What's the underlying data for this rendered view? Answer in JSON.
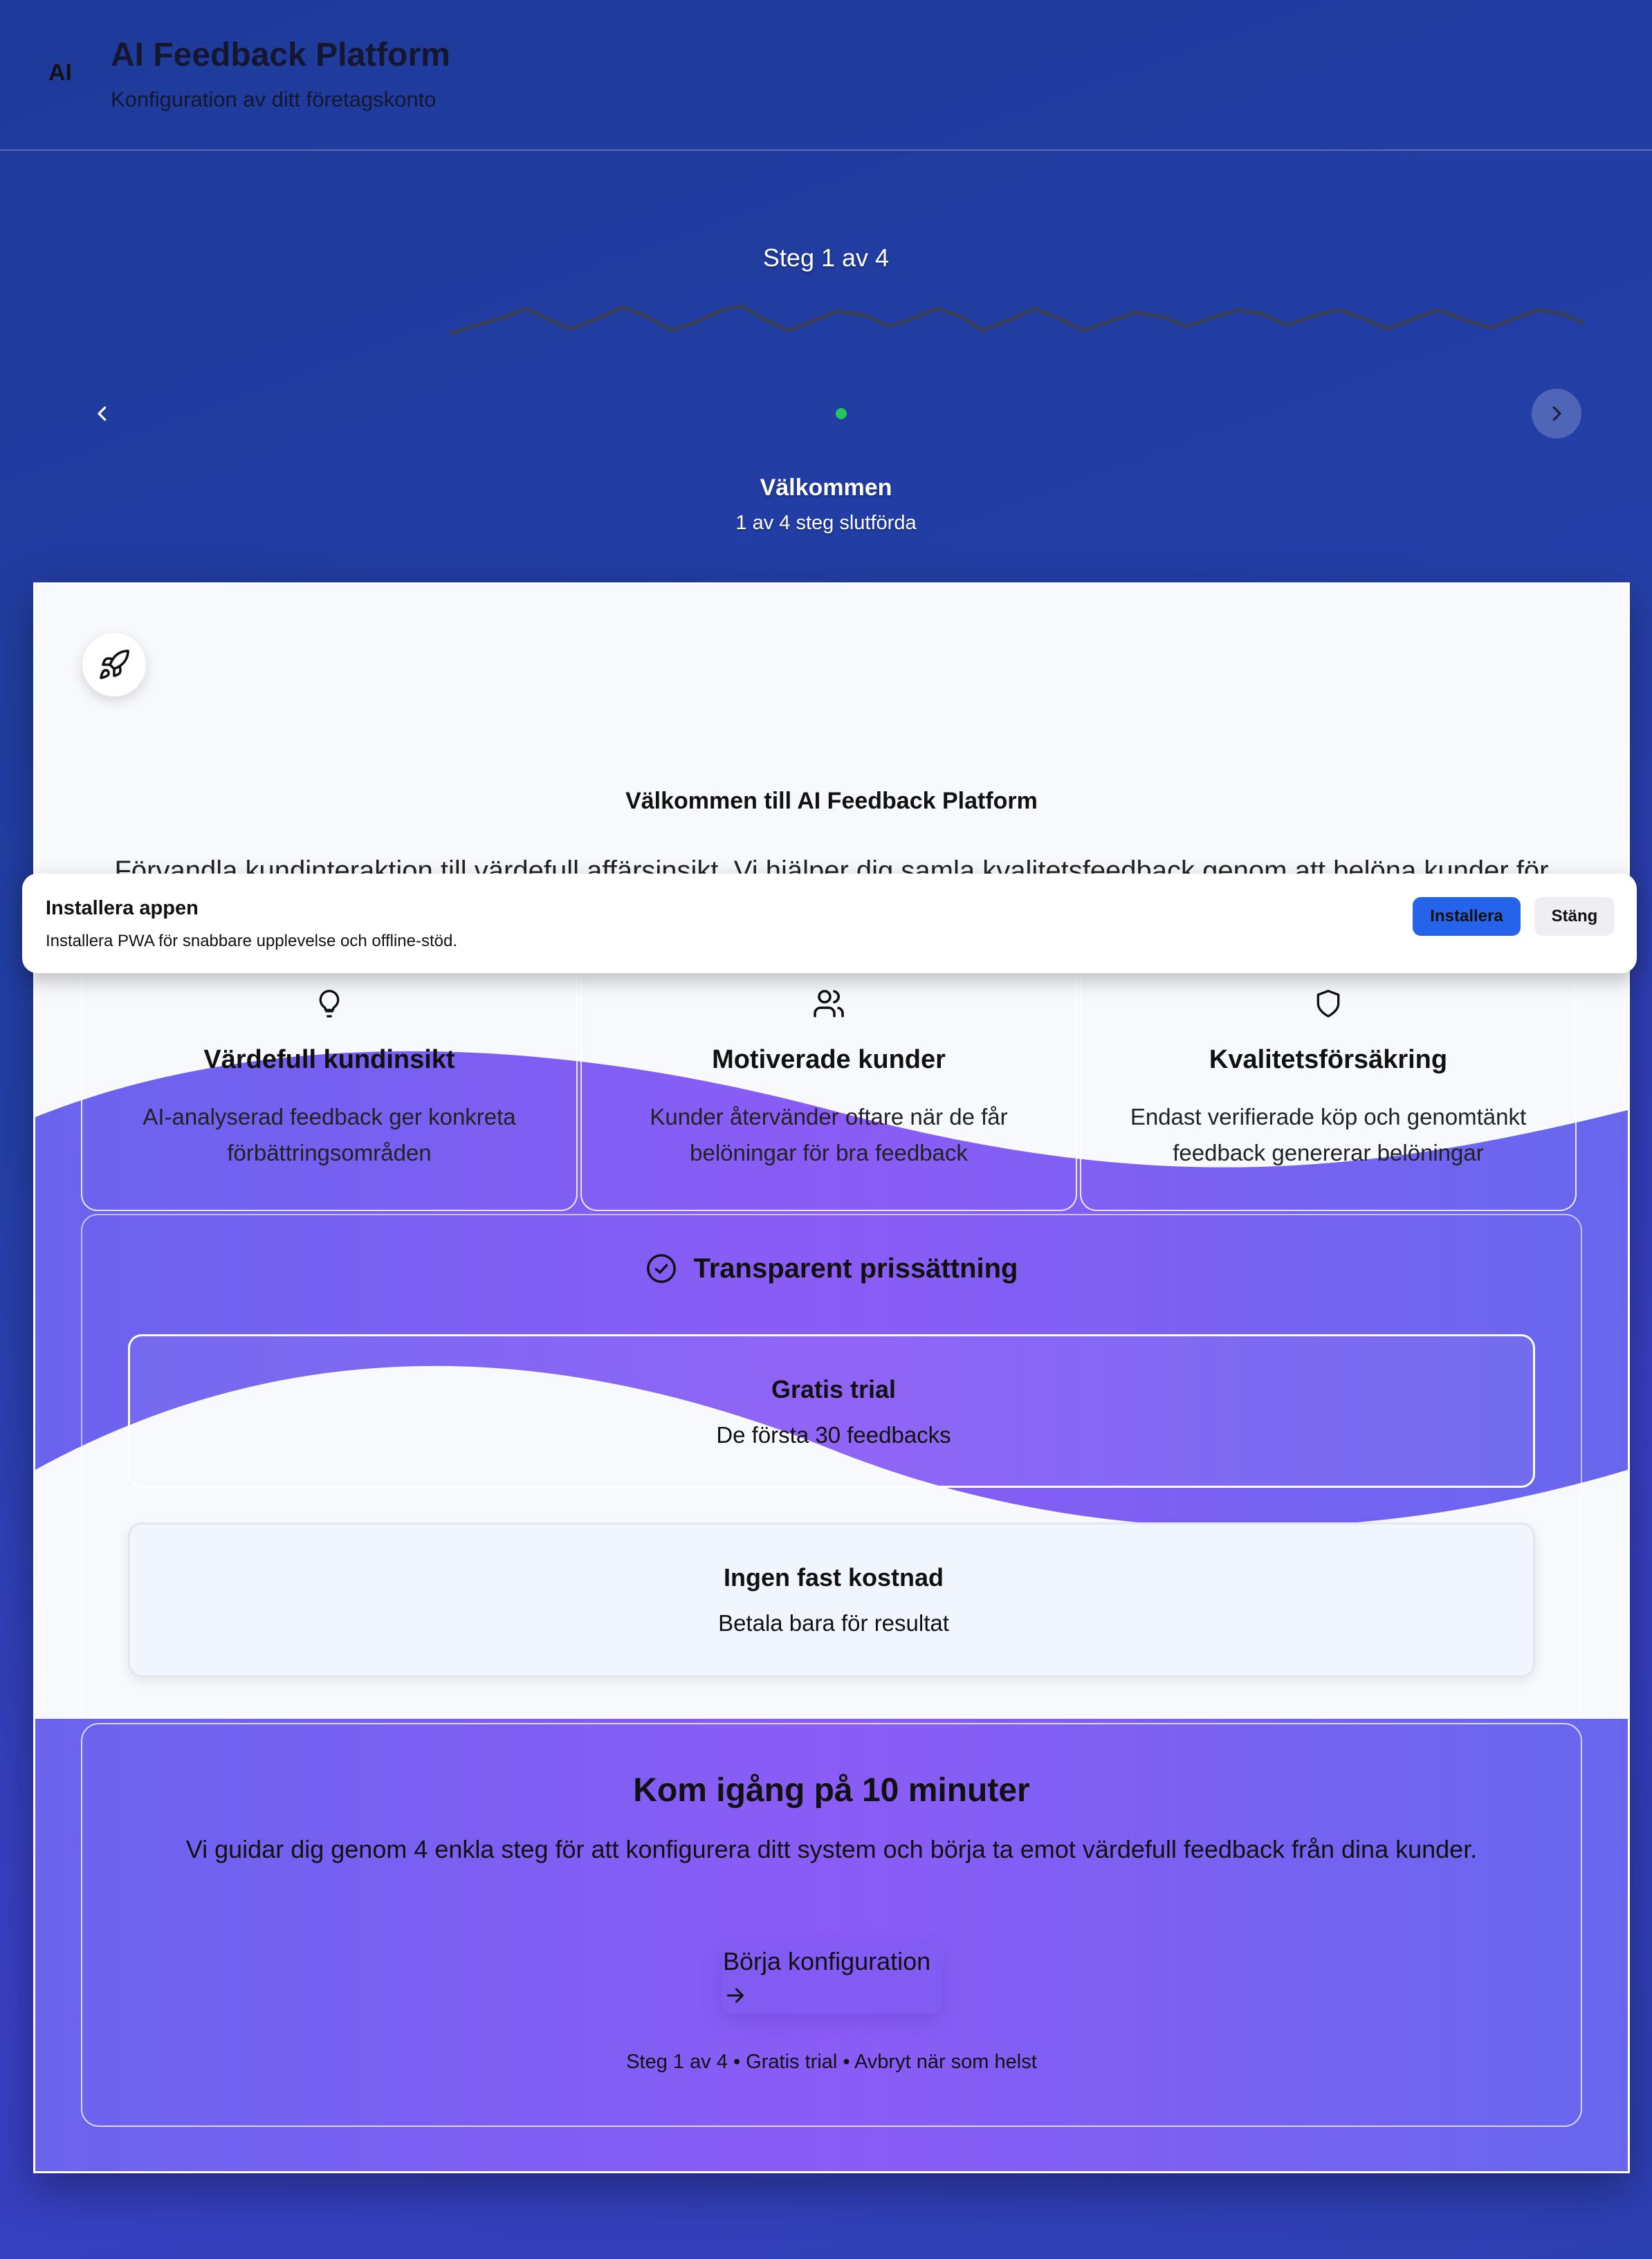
{
  "header": {
    "logo": "AI",
    "title": "AI Feedback Platform",
    "subtitle": "Konfiguration av ditt företagskonto"
  },
  "progress": {
    "step_label": "Steg 1 av 4",
    "current_step": 1,
    "total_steps": 4,
    "step_name": "Välkommen",
    "completed_text": "1 av 4 steg slutförda"
  },
  "welcome": {
    "title": "Välkommen till AI Feedback Platform",
    "description": "Förvandla kundinteraktion till värdefull affärsinsikt. Vi hjälper dig samla kvalitetsfeedback genom att belöna kunder för"
  },
  "features": [
    {
      "icon": "lightbulb-icon",
      "title": "Värdefull kundinsikt",
      "description": "AI-analyserad feedback ger konkreta förbättringsområden"
    },
    {
      "icon": "users-icon",
      "title": "Motiverade kunder",
      "description": "Kunder återvänder oftare när de får belöningar för bra feedback"
    },
    {
      "icon": "shield-icon",
      "title": "Kvalitetsförsäkring",
      "description": "Endast verifierade köp och genomtänkt feedback genererar belöningar"
    }
  ],
  "pricing": {
    "title": "Transparent prissättning",
    "plans": [
      {
        "name": "Gratis trial",
        "description": "De första 30 feedbacks"
      },
      {
        "name": "Ingen fast kostnad",
        "description": "Betala bara för resultat"
      }
    ]
  },
  "cta": {
    "title": "Kom igång på 10 minuter",
    "description": "Vi guidar dig genom 4 enkla steg för att konfigurera ditt system och börja ta emot värdefull feedback från dina kunder.",
    "button_label": "Börja konfiguration",
    "footer": "Steg 1 av 4 • Gratis trial • Avbryt när som helst"
  },
  "install_banner": {
    "title": "Installera appen",
    "description": "Installera PWA för snabbare upplevelse och offline-stöd.",
    "install_label": "Installera",
    "close_label": "Stäng"
  },
  "colors": {
    "background": "#1e3a9a",
    "accent": "#2563eb",
    "progress_dot": "#22c55e",
    "wave": "#7c5cf0"
  }
}
